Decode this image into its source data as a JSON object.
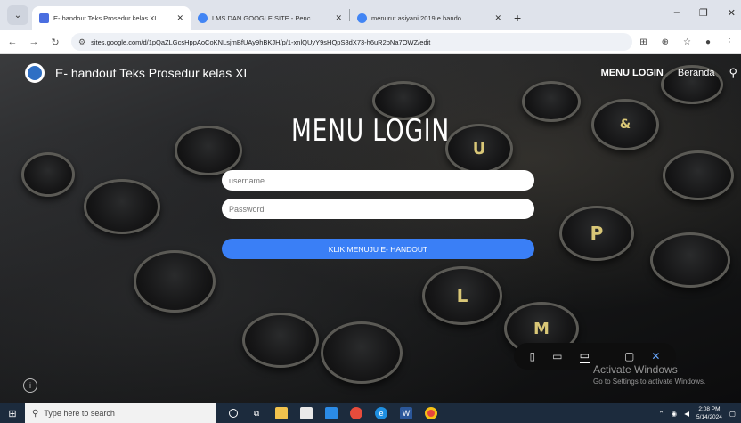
{
  "browser": {
    "tabs": [
      {
        "title": "E- handout Teks Prosedur kelas XI",
        "active": true,
        "favicon_color": "#4a6ee0"
      },
      {
        "title": "LMS DAN GOOGLE SITE - Penc",
        "active": false,
        "favicon_color": "#4285f4"
      },
      {
        "title": "menurut asiyani 2019 e hando",
        "active": false,
        "favicon_color": "#4285f4"
      }
    ],
    "url": "sites.google.com/d/1pQaZLGcsHppAoCoKNLsjmBfUAy9hBKJH/p/1-xnlQUyY9sHQpS8dX73-h6uR2bNa7OWZ/edit"
  },
  "site": {
    "title": "E- handout Teks Prosedur kelas XI",
    "nav": {
      "menu_login": "MENU LOGIN",
      "beranda": "Beranda"
    },
    "heading": "MENU LOGIN",
    "username_placeholder": "username",
    "password_placeholder": "Password",
    "submit_label": "KLIK MENUJU E- HANDOUT"
  },
  "activate_windows": {
    "title": "Activate Windows",
    "subtitle": "Go to Settings to activate Windows."
  },
  "taskbar": {
    "search_placeholder": "Type here to search",
    "time": "2:08 PM",
    "date": "5/14/2024"
  },
  "colors": {
    "accent": "#3a7ff6",
    "taskbar": "#1c2b3d"
  }
}
